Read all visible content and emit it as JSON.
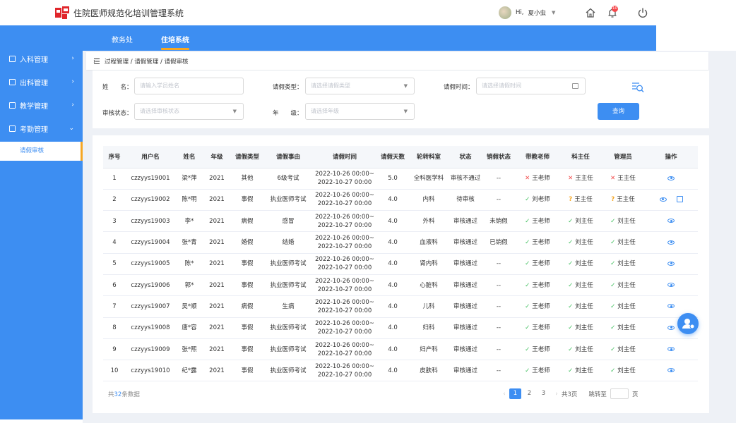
{
  "app": {
    "title": "住院医师规范化培训管理系统"
  },
  "user": {
    "greeting": "Hi,",
    "name": "夏小虫",
    "notification_count": "10"
  },
  "nav": {
    "tabs": [
      {
        "label": "教务处"
      },
      {
        "label": "住培系统"
      }
    ]
  },
  "sidebar": {
    "items": [
      {
        "label": "入科管理"
      },
      {
        "label": "出科管理"
      },
      {
        "label": "教学管理"
      },
      {
        "label": "考勤管理"
      }
    ],
    "sub_item": "请假审核"
  },
  "breadcrumb": "过程管理 / 请假管理 / 请假审核",
  "filters": {
    "name_label": "姓　　名：",
    "name_placeholder": "请输入学员姓名",
    "type_label": "请假类型：",
    "type_placeholder": "请选择请假类型",
    "time_label": "请假时间：",
    "time_placeholder": "请选择请假时间",
    "status_label": "审核状态：",
    "status_placeholder": "请选择审核状态",
    "grade_label": "年　　级：",
    "grade_placeholder": "请选择年级",
    "query_label": "查询"
  },
  "table": {
    "headers": [
      "序号",
      "用户名",
      "姓名",
      "年级",
      "请假类型",
      "请假事由",
      "请假时间",
      "请假天数",
      "轮转科室",
      "状态",
      "销假状态",
      "带教老师",
      "科主任",
      "管理员",
      "操作"
    ],
    "rows": [
      {
        "no": "1",
        "user": "czzyys19001",
        "name": "梁*萍",
        "grade": "2021",
        "type": "其他",
        "reason": "6级考试",
        "start": "2022-10-26 00:00~",
        "end": "2022-10-27 00:00",
        "days": "5.0",
        "dept": "全科医学科",
        "status": "审核不通过",
        "cancel": "--",
        "teacher": "王老师",
        "teacher_mark": "no",
        "director": "王主任",
        "director_mark": "no",
        "admin": "王主任",
        "admin_mark": "no",
        "edit": false
      },
      {
        "no": "2",
        "user": "czzyys19002",
        "name": "陈*明",
        "grade": "2021",
        "type": "事假",
        "reason": "执业医师考试",
        "start": "2022-10-26 00:00~",
        "end": "2022-10-27 00:00",
        "days": "4.0",
        "dept": "内科",
        "status": "待审核",
        "cancel": "--",
        "teacher": "刘老师",
        "teacher_mark": "ok",
        "director": "王主任",
        "director_mark": "q",
        "admin": "王主任",
        "admin_mark": "q",
        "edit": true
      },
      {
        "no": "3",
        "user": "czzyys19003",
        "name": "李*",
        "grade": "2021",
        "type": "病假",
        "reason": "感冒",
        "start": "2022-10-26 00:00~",
        "end": "2022-10-27 00:00",
        "days": "4.0",
        "dept": "外科",
        "status": "审核通过",
        "cancel": "未销假",
        "teacher": "王老师",
        "teacher_mark": "ok",
        "director": "刘主任",
        "director_mark": "ok",
        "admin": "刘主任",
        "admin_mark": "ok",
        "edit": false
      },
      {
        "no": "4",
        "user": "czzyys19004",
        "name": "张*青",
        "grade": "2021",
        "type": "婚假",
        "reason": "结婚",
        "start": "2022-10-26 00:00~",
        "end": "2022-10-27 00:00",
        "days": "4.0",
        "dept": "血液科",
        "status": "审核通过",
        "cancel": "已销假",
        "teacher": "王老师",
        "teacher_mark": "ok",
        "director": "刘主任",
        "director_mark": "ok",
        "admin": "刘主任",
        "admin_mark": "ok",
        "edit": false
      },
      {
        "no": "5",
        "user": "czzyys19005",
        "name": "陈*",
        "grade": "2021",
        "type": "事假",
        "reason": "执业医师考试",
        "start": "2022-10-26 00:00~",
        "end": "2022-10-27 00:00",
        "days": "4.0",
        "dept": "肾内科",
        "status": "审核通过",
        "cancel": "--",
        "teacher": "王老师",
        "teacher_mark": "ok",
        "director": "刘主任",
        "director_mark": "ok",
        "admin": "刘主任",
        "admin_mark": "ok",
        "edit": false
      },
      {
        "no": "6",
        "user": "czzyys19006",
        "name": "郭*",
        "grade": "2021",
        "type": "事假",
        "reason": "执业医师考试",
        "start": "2022-10-26 00:00~",
        "end": "2022-10-27 00:00",
        "days": "4.0",
        "dept": "心脏科",
        "status": "审核通过",
        "cancel": "--",
        "teacher": "王老师",
        "teacher_mark": "ok",
        "director": "刘主任",
        "director_mark": "ok",
        "admin": "刘主任",
        "admin_mark": "ok",
        "edit": false
      },
      {
        "no": "7",
        "user": "czzyys19007",
        "name": "吴*顺",
        "grade": "2021",
        "type": "病假",
        "reason": "生病",
        "start": "2022-10-26 00:00~",
        "end": "2022-10-27 00:00",
        "days": "4.0",
        "dept": "儿科",
        "status": "审核通过",
        "cancel": "--",
        "teacher": "王老师",
        "teacher_mark": "ok",
        "director": "刘主任",
        "director_mark": "ok",
        "admin": "刘主任",
        "admin_mark": "ok",
        "edit": false
      },
      {
        "no": "8",
        "user": "czzyys19008",
        "name": "唐*容",
        "grade": "2021",
        "type": "事假",
        "reason": "执业医师考试",
        "start": "2022-10-26 00:00~",
        "end": "2022-10-27 00:00",
        "days": "4.0",
        "dept": "妇科",
        "status": "审核通过",
        "cancel": "--",
        "teacher": "王老师",
        "teacher_mark": "ok",
        "director": "刘主任",
        "director_mark": "ok",
        "admin": "刘主任",
        "admin_mark": "ok",
        "edit": false
      },
      {
        "no": "9",
        "user": "czzyys19009",
        "name": "张*熙",
        "grade": "2021",
        "type": "事假",
        "reason": "执业医师考试",
        "start": "2022-10-26 00:00~",
        "end": "2022-10-27 00:00",
        "days": "4.0",
        "dept": "妇产科",
        "status": "审核通过",
        "cancel": "--",
        "teacher": "王老师",
        "teacher_mark": "ok",
        "director": "刘主任",
        "director_mark": "ok",
        "admin": "刘主任",
        "admin_mark": "ok",
        "edit": false
      },
      {
        "no": "10",
        "user": "czzyys19010",
        "name": "纪*露",
        "grade": "2021",
        "type": "事假",
        "reason": "执业医师考试",
        "start": "2022-10-26 00:00~",
        "end": "2022-10-27 00:00",
        "days": "4.0",
        "dept": "皮肤科",
        "status": "审核通过",
        "cancel": "--",
        "teacher": "王老师",
        "teacher_mark": "ok",
        "director": "刘主任",
        "director_mark": "ok",
        "admin": "刘主任",
        "admin_mark": "ok",
        "edit": false
      }
    ]
  },
  "pagination": {
    "total_prefix": "共",
    "total_count": "32",
    "total_suffix": "条数据",
    "pages": [
      "1",
      "2",
      "3"
    ],
    "current_page": "1",
    "page_count_label": "共3页",
    "jump_label": "跳转至",
    "jump_suffix": "页"
  },
  "colors": {
    "primary": "#3d8ef2",
    "accent": "#f5a623",
    "success": "#3fbf5d",
    "danger": "#f24a4a",
    "badge": "#f5484c"
  }
}
